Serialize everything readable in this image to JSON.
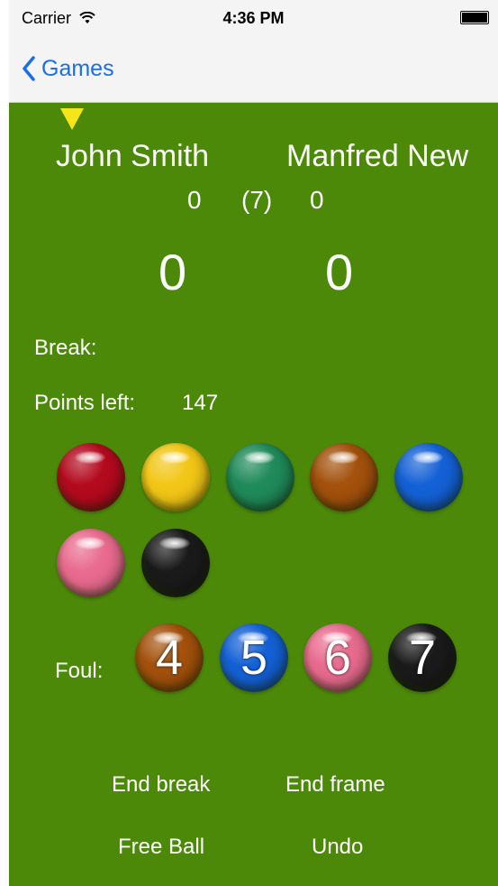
{
  "status": {
    "carrier": "Carrier",
    "time": "4:36 PM"
  },
  "nav": {
    "back_label": "Games"
  },
  "game": {
    "player1": "John Smith",
    "player2": "Manfred New",
    "frames1": "0",
    "frames_total": "(7)",
    "frames2": "0",
    "score1": "0",
    "score2": "0",
    "break_label": "Break:",
    "points_left_label": "Points left:",
    "points_left_value": "147"
  },
  "balls": [
    {
      "name": "red",
      "color": "#b40a1e"
    },
    {
      "name": "yellow",
      "color": "#f2c616"
    },
    {
      "name": "green",
      "color": "#1f8a5a"
    },
    {
      "name": "brown",
      "color": "#a3510c"
    },
    {
      "name": "blue",
      "color": "#1461d6"
    },
    {
      "name": "pink",
      "color": "#e96b8f"
    },
    {
      "name": "black",
      "color": "#1a1a1a"
    }
  ],
  "foul": {
    "label": "Foul:",
    "balls": [
      {
        "name": "brown",
        "color": "#a3510c",
        "value": "4"
      },
      {
        "name": "blue",
        "color": "#1461d6",
        "value": "5"
      },
      {
        "name": "pink",
        "color": "#e96b8f",
        "value": "6"
      },
      {
        "name": "black",
        "color": "#1a1a1a",
        "value": "7"
      }
    ]
  },
  "actions": {
    "end_break": "End break",
    "end_frame": "End frame",
    "free_ball": "Free Ball",
    "undo": "Undo"
  },
  "colors": {
    "table_green": "#4c8909",
    "ios_blue": "#1a6fe8",
    "turn_marker": "#f7e51b"
  },
  "icons": {
    "back": "chevron-left-icon",
    "wifi": "wifi-icon",
    "battery": "battery-icon",
    "turn": "triangle-down-icon"
  }
}
